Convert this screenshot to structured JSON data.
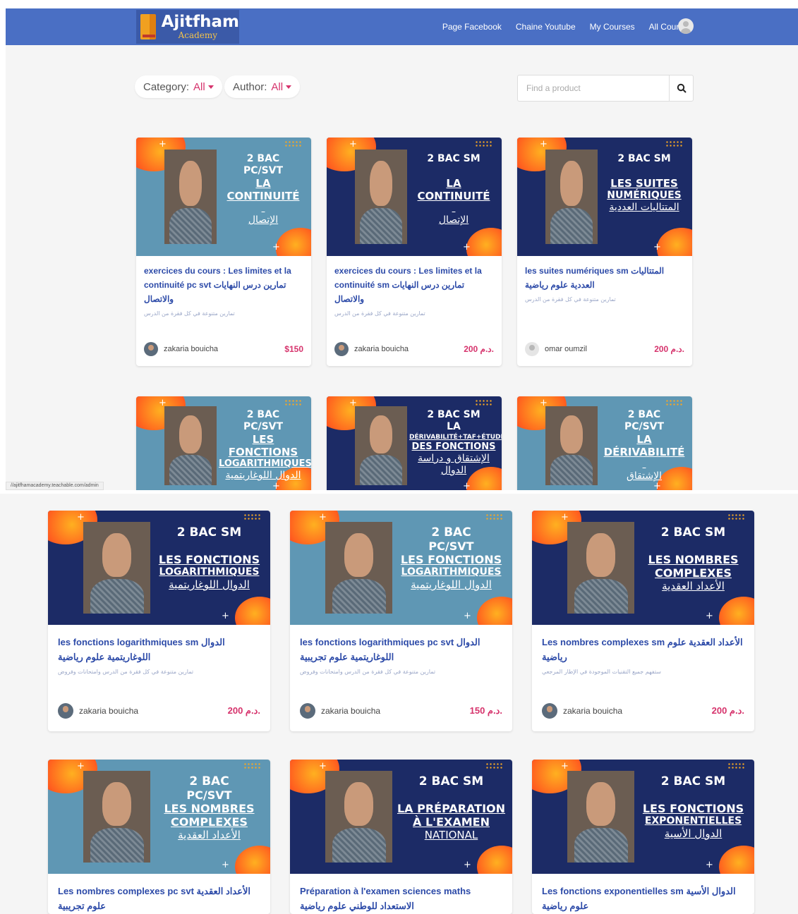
{
  "navbar": {
    "logo_main": "Ajitfham",
    "logo_sub": "Academy",
    "links": [
      "Page Facebook",
      "Chaine Youtube",
      "My Courses",
      "All Courses"
    ],
    "accent": "#4a6fc4"
  },
  "filters": {
    "category_label": "Category:",
    "category_value": "All",
    "author_label": "Author:",
    "author_value": "All"
  },
  "search": {
    "placeholder": "Find a product"
  },
  "status_url": "//ajitfhamacademy.teachable.com/admin",
  "top_courses": [
    {
      "thumb_bg": "#5f97b4",
      "thumb_lines": [
        "2 BAC",
        "PC/SVT",
        "LA CONTINUITÉ",
        "",
        "الإتصال"
      ],
      "title": "exercices du cours : Les limites et la continuité pc svt تمارين درس النهايات والاتصال",
      "desc": "تمارين متنوعة في كل فقرة من الدرس",
      "author": "zakaria bouicha",
      "price": "$150"
    },
    {
      "thumb_bg": "#1c2b66",
      "thumb_lines": [
        "2 BAC SM",
        "",
        "LA CONTINUITÉ",
        "",
        "الإتصال"
      ],
      "title": "exercices du cours : Les limites et la continuité sm تمارين درس النهايات والاتصال",
      "desc": "تمارين متنوعة في كل فقرة من الدرس",
      "author": "zakaria bouicha",
      "price": "200 د.م."
    },
    {
      "thumb_bg": "#1c2b66",
      "thumb_lines": [
        "2 BAC SM",
        "",
        "LES SUITES",
        "NUMÉRIQUES",
        "المتتاليات العددية"
      ],
      "title": "les suites numériques sm المتتاليات العددية علوم رياضية",
      "desc": "تمارين متنوعة في كل فقرة من الدرس",
      "author": "omar oumzil",
      "price": "200 د.م."
    },
    {
      "thumb_bg": "#5f97b4",
      "thumb_lines": [
        "2 BAC",
        "PC/SVT",
        "LES FONCTIONS",
        "LOGARITHMIQUES",
        "الدوال اللوغاريتمية"
      ]
    },
    {
      "thumb_bg": "#1c2b66",
      "thumb_lines": [
        "2 BAC SM",
        "LA",
        "DÉRIVABILITÉ+TAF+ÉTUDE",
        "DES FONCTIONS",
        "الإشتقاق و دراسة الدوال"
      ]
    },
    {
      "thumb_bg": "#5f97b4",
      "thumb_lines": [
        "2 BAC",
        "PC/SVT",
        "LA DÉRIVABILITÉ",
        "",
        "الإشتقاق"
      ]
    }
  ],
  "bottom_courses": [
    {
      "thumb_bg": "#1c2b66",
      "thumb_lines": [
        "2 BAC SM",
        "",
        "LES FONCTIONS",
        "LOGARITHMIQUES",
        "الدوال اللوغاريتمية"
      ],
      "title": "les fonctions logarithmiques sm الدوال اللوغاريتمية علوم رياضية",
      "desc": "تمارين متنوعة في كل فقرة من الدرس وامتحانات وفروض",
      "author": "zakaria bouicha",
      "price": "200 د.م."
    },
    {
      "thumb_bg": "#5f97b4",
      "thumb_lines": [
        "2 BAC",
        "PC/SVT",
        "LES FONCTIONS",
        "LOGARITHMIQUES",
        "الدوال اللوغاريتمية"
      ],
      "title": "les fonctions logarithmiques pc svt الدوال اللوغاريتمية علوم تجريبية",
      "desc": "تمارين متنوعة في كل فقرة من الدرس وامتحانات وفروض",
      "author": "zakaria bouicha",
      "price": "150 د.م."
    },
    {
      "thumb_bg": "#1c2b66",
      "thumb_lines": [
        "2 BAC SM",
        "",
        "LES NOMBRES",
        "COMPLEXES",
        "الأعداد العقدية"
      ],
      "title": "Les nombres complexes sm الأعداد العقدية علوم رياضية",
      "desc": "ستفهم جميع التقنيات الموجودة في الإطار المرجعي",
      "author": "zakaria bouicha",
      "price": "200 د.م."
    },
    {
      "thumb_bg": "#5f97b4",
      "thumb_lines": [
        "2 BAC",
        "PC/SVT",
        "LES NOMBRES",
        "COMPLEXES",
        "الأعداد العقدية"
      ],
      "title": "Les nombres complexes pc svt الأعداد العقدية علوم تجريبية"
    },
    {
      "thumb_bg": "#1c2b66",
      "thumb_lines": [
        "2 BAC SM",
        "",
        "LA PRÉPARATION",
        "À L'EXAMEN",
        "NATIONAL"
      ],
      "title": "Préparation à l'examen sciences maths الاستعداد للوطني علوم رياضية"
    },
    {
      "thumb_bg": "#1c2b66",
      "thumb_lines": [
        "2 BAC SM",
        "",
        "LES FONCTIONS",
        "EXPONENTIELLES",
        "الدوال الأسية"
      ],
      "title": "Les fonctions exponentielles sm الدوال الأسية علوم رياضية"
    }
  ]
}
